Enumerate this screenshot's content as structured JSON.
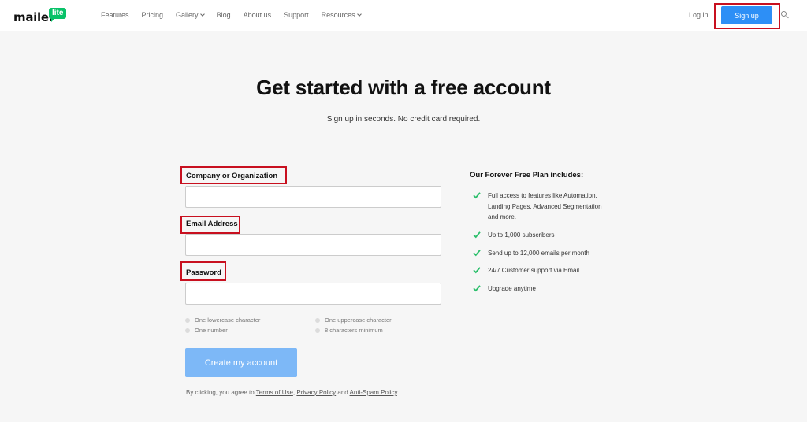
{
  "header": {
    "logo": {
      "word": "mailer",
      "badge": "lite"
    },
    "nav": [
      {
        "label": "Features",
        "has_dropdown": false
      },
      {
        "label": "Pricing",
        "has_dropdown": false
      },
      {
        "label": "Gallery",
        "has_dropdown": true
      },
      {
        "label": "Blog",
        "has_dropdown": false
      },
      {
        "label": "About us",
        "has_dropdown": false
      },
      {
        "label": "Support",
        "has_dropdown": false
      },
      {
        "label": "Resources",
        "has_dropdown": true
      }
    ],
    "login_label": "Log in",
    "signup_label": "Sign up"
  },
  "hero": {
    "title": "Get started with a free account",
    "subtitle": "Sign up in seconds. No credit card required."
  },
  "form": {
    "company_label": "Company or Organization",
    "company_value": "",
    "email_label": "Email Address",
    "email_value": "",
    "password_label": "Password",
    "password_value": "",
    "requirements": [
      "One lowercase character",
      "One uppercase character",
      "One number",
      "8 characters minimum"
    ],
    "submit_label": "Create my account"
  },
  "terms": {
    "prefix": "By clicking, you agree to ",
    "terms_link": "Terms of Use",
    "sep1": ", ",
    "privacy_link": "Privacy Policy",
    "sep2": " and ",
    "antispam_link": "Anti-Spam Policy",
    "suffix": "."
  },
  "plan": {
    "title": "Our Forever Free Plan includes:",
    "features": [
      "Full access to features like Automation, Landing Pages, Advanced Segmentation and more.",
      "Up to 1,000 subscribers",
      "Send up to 12,000 emails per month",
      "24/7 Customer support via Email",
      "Upgrade anytime"
    ]
  },
  "colors": {
    "brand_green": "#09c269",
    "primary_blue": "#2d8ff6",
    "disabled_blue": "#7db8f7",
    "highlight_red": "#c8101f",
    "check_green": "#2bbf6b"
  }
}
